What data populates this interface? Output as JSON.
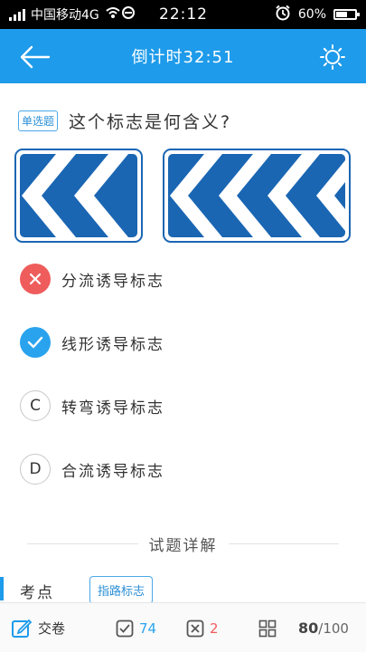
{
  "status_bar": {
    "carrier": "中国移动4G",
    "time": "22:12",
    "battery": "60%",
    "battery_level": 0.6
  },
  "app_bar": {
    "title": "倒计时32:51",
    "back_icon": "arrow-left-icon",
    "theme_icon": "sun-icon"
  },
  "question": {
    "type": "单选题",
    "text": "这个标志是何含义?"
  },
  "options": [
    {
      "marker": "",
      "state": "wrong",
      "text": "分流诱导标志"
    },
    {
      "marker": "",
      "state": "correct",
      "text": "线形诱导标志"
    },
    {
      "marker": "C",
      "state": "none",
      "text": "转弯诱导标志"
    },
    {
      "marker": "D",
      "state": "none",
      "text": "合流诱导标志"
    }
  ],
  "details": {
    "heading": "试题详解",
    "keypoint_label": "考点",
    "keypoint_tag": "指路标志"
  },
  "bottom_bar": {
    "submit": "交卷",
    "correct_count": "74",
    "wrong_count": "2",
    "progress_current": "80",
    "progress_total": "/100"
  },
  "colors": {
    "primary": "#1e9bea",
    "wrong": "#ef5c5c",
    "correct": "#2aa3ee",
    "sign_blue": "#1a66b3"
  }
}
